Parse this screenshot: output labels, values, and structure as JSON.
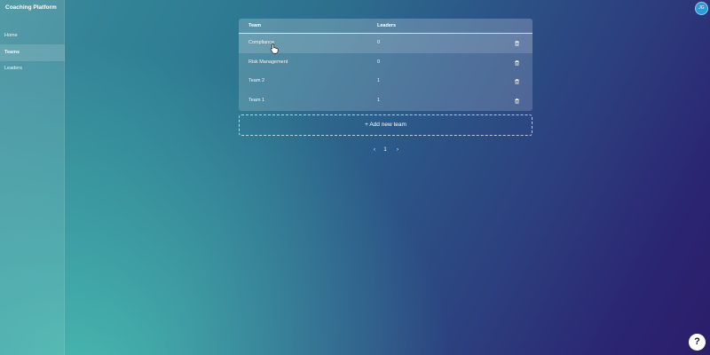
{
  "sidebar": {
    "brand": "Coaching Platform",
    "items": [
      {
        "label": "Home"
      },
      {
        "label": "Teams"
      },
      {
        "label": "Leaders"
      }
    ]
  },
  "user": {
    "initials": "JG"
  },
  "table": {
    "headers": {
      "team": "Team",
      "leaders": "Leaders"
    },
    "rows": [
      {
        "team": "Compliance",
        "leaders": "0"
      },
      {
        "team": "Risk Management",
        "leaders": "0"
      },
      {
        "team": "Team 2",
        "leaders": "1"
      },
      {
        "team": "Team 1",
        "leaders": "1"
      }
    ]
  },
  "add_team_label": "+ Add new team",
  "pagination": {
    "prev": "‹",
    "current": "1",
    "next": "›"
  },
  "help_label": "?",
  "icons": {
    "delete": "trash-icon",
    "cursor": "hand-pointer-icon"
  },
  "colors": {
    "avatar": "#2d9ad9",
    "help_bg": "#ffffff"
  }
}
